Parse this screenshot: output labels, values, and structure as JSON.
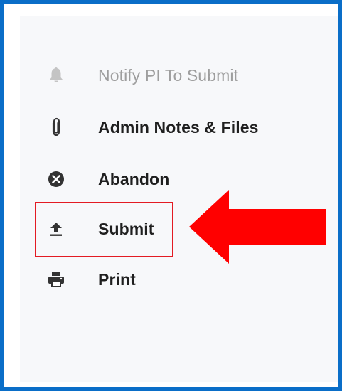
{
  "menu": {
    "items": [
      {
        "label": "Notify PI To Submit",
        "icon": "bell-icon",
        "enabled": false
      },
      {
        "label": "Admin Notes & Files",
        "icon": "paperclip-icon",
        "enabled": true
      },
      {
        "label": "Abandon",
        "icon": "close-circle-icon",
        "enabled": true
      },
      {
        "label": "Submit",
        "icon": "upload-icon",
        "enabled": true
      },
      {
        "label": "Print",
        "icon": "printer-icon",
        "enabled": true
      }
    ]
  },
  "annotation": {
    "highlighted_item": "Submit",
    "highlight_color": "#e31b23",
    "arrow_color": "#ff0000"
  },
  "colors": {
    "frame_border": "#0a6ec8",
    "panel_background": "#f7f8fa",
    "text": "#1f1f1f",
    "disabled_text": "#9e9e9e"
  }
}
